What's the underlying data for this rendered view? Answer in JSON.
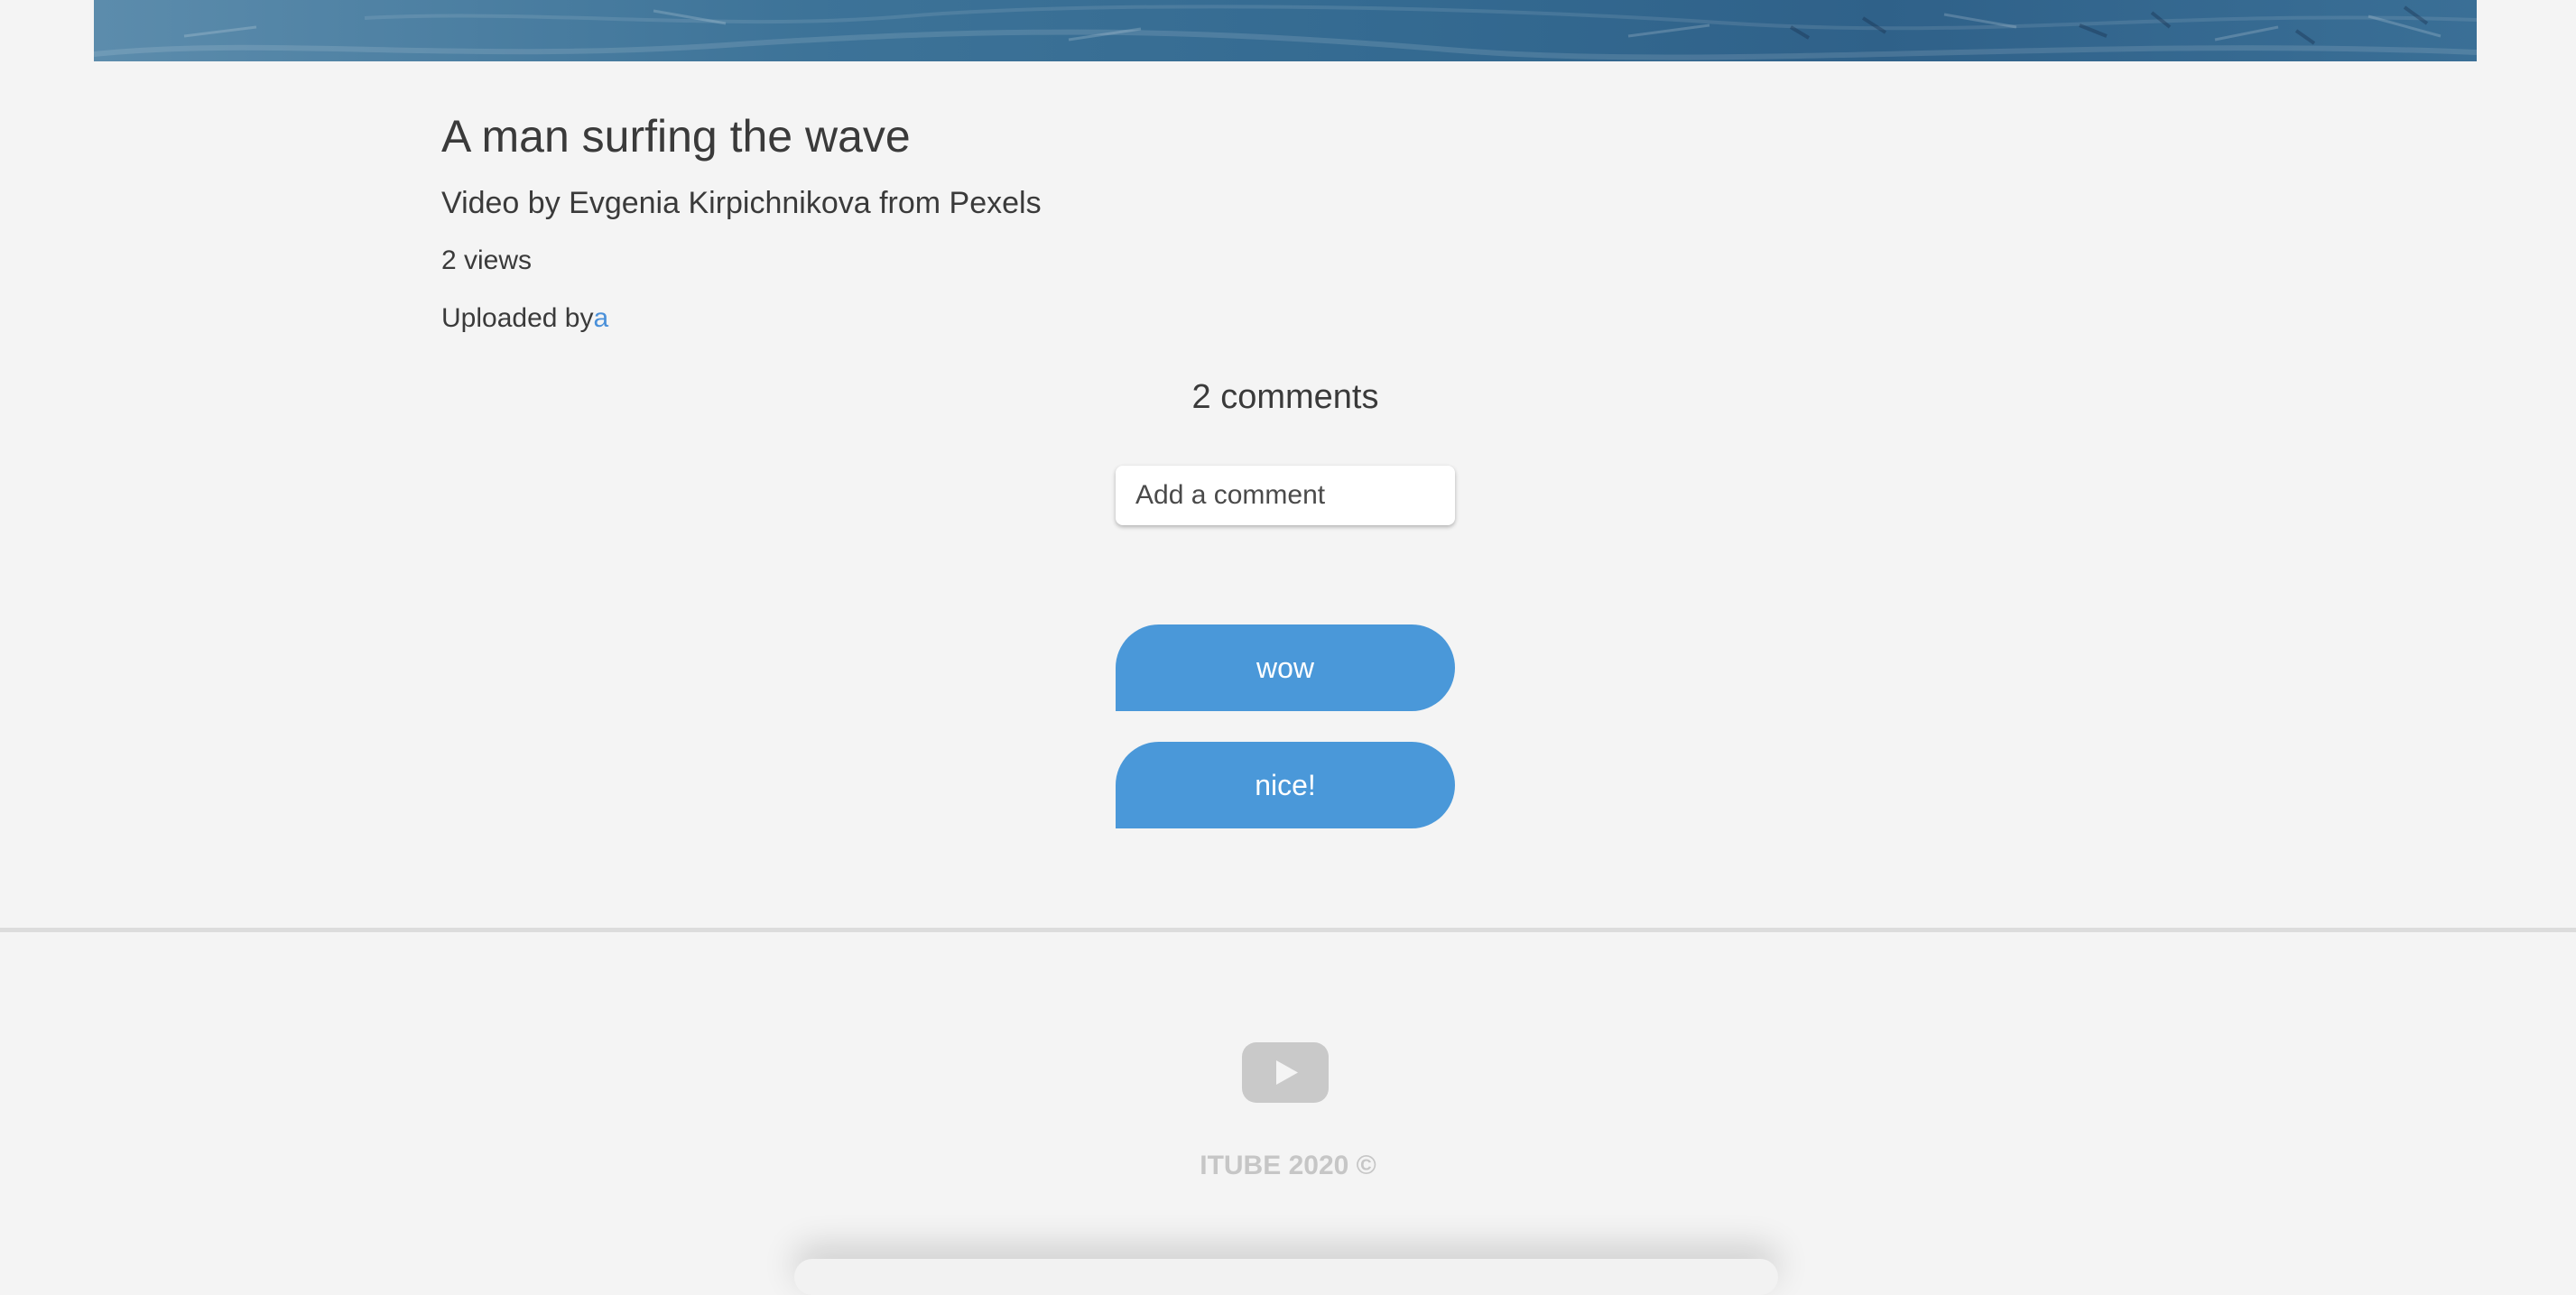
{
  "video": {
    "title": "A man surfing the wave",
    "description": "Video by Evgenia Kirpichnikova from Pexels",
    "views": "2 views",
    "uploaded_by_label": "Uploaded by",
    "uploader_name": "a"
  },
  "comments": {
    "count_label": "2 comments",
    "input_placeholder": "Add a comment",
    "items": [
      {
        "text": "wow"
      },
      {
        "text": "nice!"
      }
    ]
  },
  "footer": {
    "logo_icon": "play-button-icon",
    "copyright": "ITUBE 2020 ©"
  },
  "colors": {
    "background": "#f4f4f4",
    "accent": "#4a98d9",
    "link": "#4a90d9",
    "text": "#3a3a3a",
    "footer_text": "#c6c6c6",
    "divider": "#dcdcdc"
  }
}
